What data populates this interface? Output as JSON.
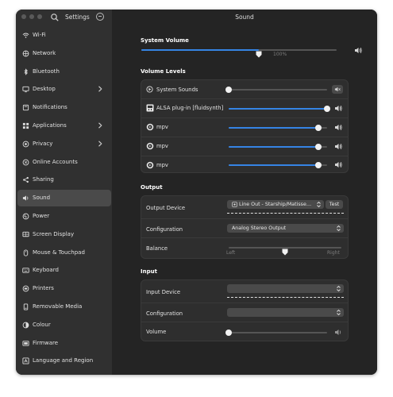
{
  "window": {
    "sidebar_title": "Settings",
    "main_title": "Sound"
  },
  "sidebar": {
    "items": [
      {
        "label": "Wi-Fi",
        "icon": "wifi-icon"
      },
      {
        "label": "Network",
        "icon": "network-icon"
      },
      {
        "label": "Bluetooth",
        "icon": "bluetooth-icon"
      },
      {
        "label": "Desktop",
        "icon": "desktop-icon",
        "has_chevron": true
      },
      {
        "label": "Notifications",
        "icon": "notifications-icon"
      },
      {
        "label": "Applications",
        "icon": "applications-icon",
        "has_chevron": true
      },
      {
        "label": "Privacy",
        "icon": "privacy-icon",
        "has_chevron": true
      },
      {
        "label": "Online Accounts",
        "icon": "online-accounts-icon"
      },
      {
        "label": "Sharing",
        "icon": "sharing-icon"
      },
      {
        "label": "Sound",
        "icon": "sound-icon",
        "active": true
      },
      {
        "label": "Power",
        "icon": "power-icon"
      },
      {
        "label": "Screen Display",
        "icon": "display-icon"
      },
      {
        "label": "Mouse & Touchpad",
        "icon": "mouse-icon"
      },
      {
        "label": "Keyboard",
        "icon": "keyboard-icon"
      },
      {
        "label": "Printers",
        "icon": "printer-icon"
      },
      {
        "label": "Removable Media",
        "icon": "removable-media-icon"
      },
      {
        "label": "Colour",
        "icon": "colour-icon"
      },
      {
        "label": "Firmware",
        "icon": "firmware-icon"
      },
      {
        "label": "Language and Region",
        "icon": "language-icon"
      }
    ]
  },
  "system_volume": {
    "heading": "System Volume",
    "level_percent": 60,
    "mark_label": "100%"
  },
  "volume_levels": {
    "heading": "Volume Levels",
    "rows": [
      {
        "label": "System Sounds",
        "level_percent": 0,
        "muted": true
      },
      {
        "label": "ALSA plug-in [fluidsynth]",
        "level_percent": 100,
        "muted": false
      },
      {
        "label": "mpv",
        "level_percent": 91,
        "muted": false
      },
      {
        "label": "mpv",
        "level_percent": 91,
        "muted": false
      },
      {
        "label": "mpv",
        "level_percent": 91,
        "muted": false
      }
    ]
  },
  "output": {
    "heading": "Output",
    "device_label": "Output Device",
    "device_value": "Line Out - Starship/Matisse HD Audio Controller",
    "test_label": "Test",
    "configuration_label": "Configuration",
    "configuration_value": "Analog Stereo Output",
    "balance_label": "Balance",
    "balance_left": "Left",
    "balance_right": "Right",
    "balance_percent": 50
  },
  "input": {
    "heading": "Input",
    "device_label": "Input Device",
    "device_value": "",
    "configuration_label": "Configuration",
    "configuration_value": "",
    "volume_label": "Volume",
    "volume_percent": 0
  },
  "colors": {
    "accent": "#3584e4",
    "window_bg": "#242424",
    "sidebar_bg": "#303030",
    "card_bg": "#2e2e2e"
  }
}
